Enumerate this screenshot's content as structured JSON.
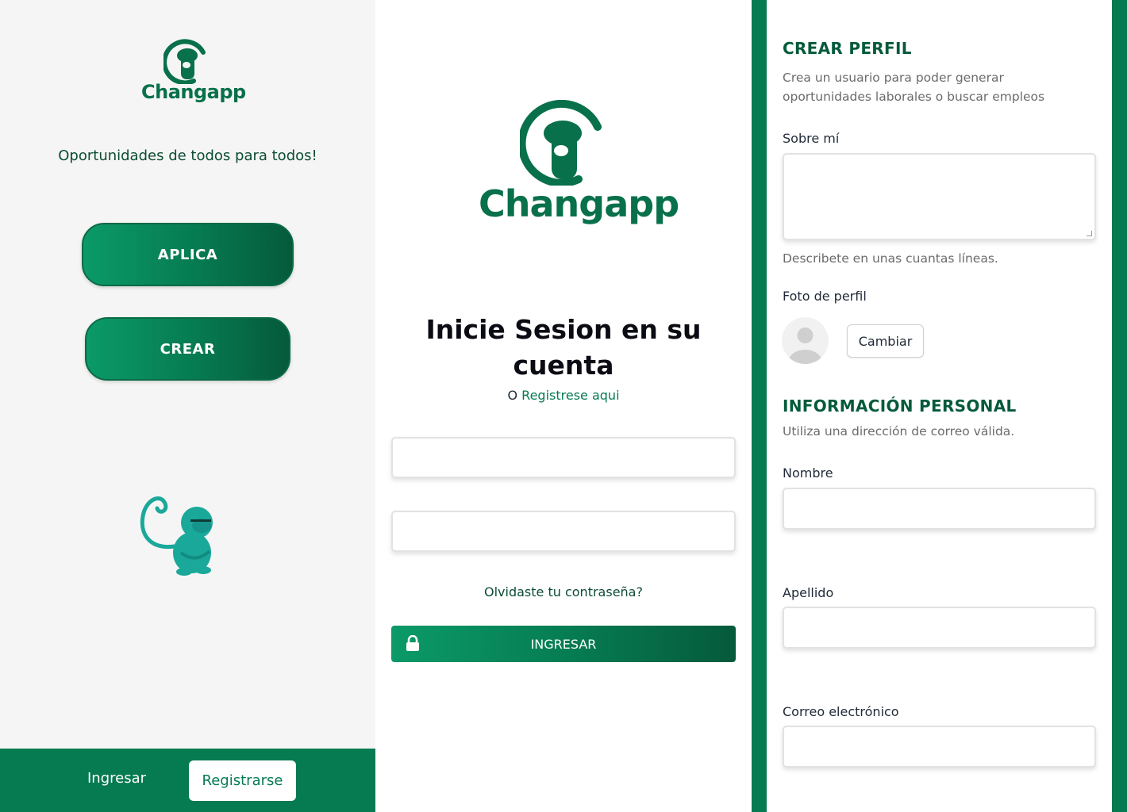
{
  "brand": {
    "name": "Changapp",
    "primary_color": "#067a51",
    "dark_color": "#055a3b",
    "mascot_color": "#1aa89a"
  },
  "landing": {
    "tagline": "Oportunidades de todos para todos!",
    "aplica_button": "APLICA",
    "crear_button": "CREAR",
    "footer": {
      "ingresar": "Ingresar",
      "registrarse": "Registrarse"
    }
  },
  "login": {
    "title": "Inicie Sesion en su cuenta",
    "register_prefix": "O ",
    "register_link": "Registrese aqui",
    "forgot_password": "Olvidaste tu contraseña?",
    "submit_button": "INGRESAR",
    "username_value": "",
    "password_value": ""
  },
  "profile": {
    "heading": "CREAR PERFIL",
    "description": "Crea un usuario para poder generar oportunidades laborales o buscar empleos",
    "about_label": "Sobre mí",
    "about_value": "",
    "about_help": "Describete en unas cuantas líneas.",
    "photo_label": "Foto de perfil",
    "change_button": "Cambiar",
    "personal_heading": "INFORMACIÓN PERSONAL",
    "personal_description": "Utiliza una dirección de correo válida.",
    "first_name_label": "Nombre",
    "last_name_label": "Apellido",
    "email_label": "Correo electrónico"
  }
}
